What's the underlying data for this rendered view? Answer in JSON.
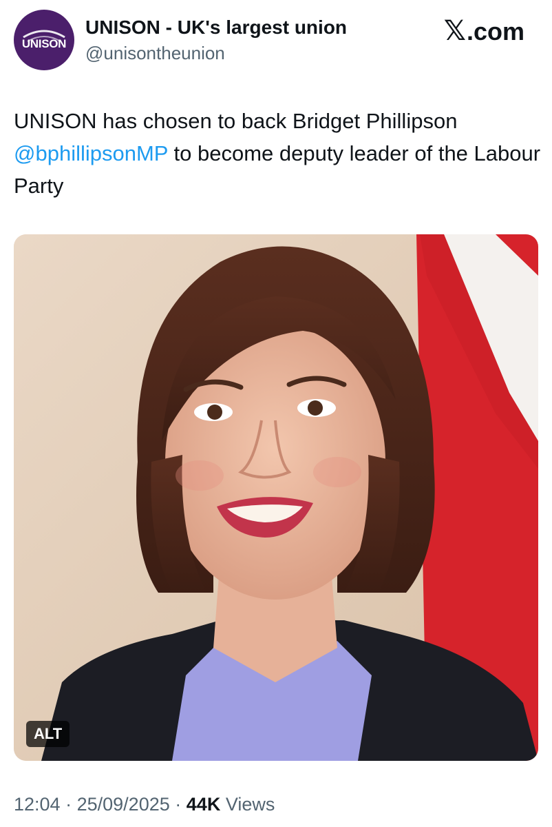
{
  "author": {
    "display_name": "UNISON - UK's largest union",
    "handle": "@unisontheunion",
    "avatar_text": "UNISON"
  },
  "brand": {
    "x_glyph": "𝕏",
    "suffix": ".com"
  },
  "post": {
    "text_before": "UNISON has chosen to back Bridget Phillipson ",
    "mention": "@bphillipsonMP",
    "text_after": " to become deputy leader of the Labour Party"
  },
  "media": {
    "alt_badge": "ALT"
  },
  "meta": {
    "time": "12:04",
    "separator": "·",
    "date": "25/09/2025",
    "views_count": "44K",
    "views_label": "Views"
  },
  "colors": {
    "mention": "#1d9bf0",
    "secondary_text": "#536471",
    "avatar_bg": "#4b1f6b"
  }
}
